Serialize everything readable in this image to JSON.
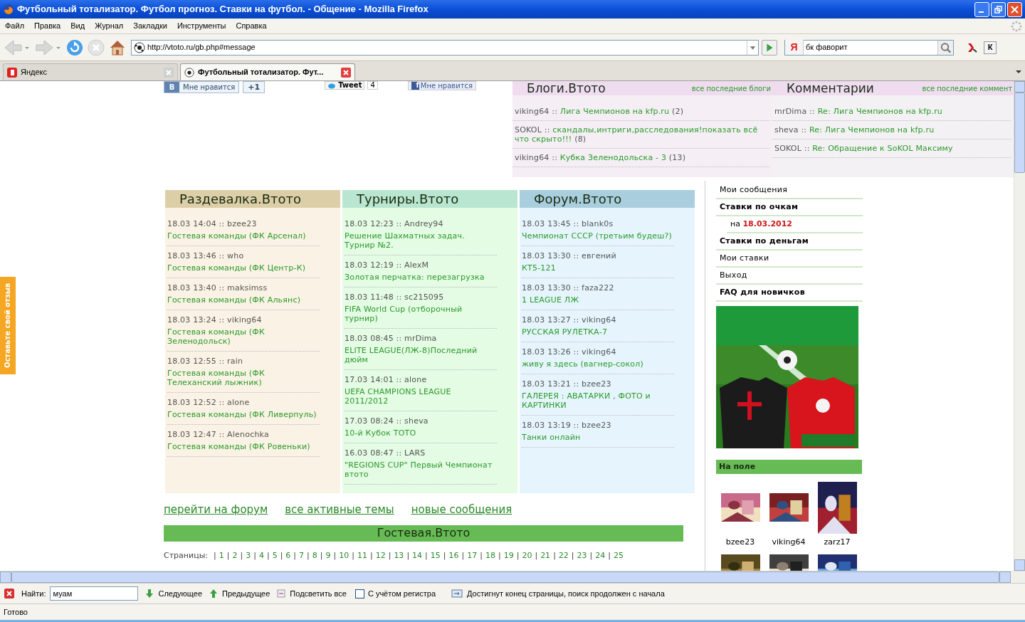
{
  "window": {
    "title": "Футбольный тотализатор. Футбол прогноз. Ставки на футбол. - Общение - Mozilla Firefox"
  },
  "menu": [
    "Файл",
    "Правка",
    "Вид",
    "Журнал",
    "Закладки",
    "Инструменты",
    "Справка"
  ],
  "toolbar": {
    "url": "http://vtoto.ru/gb.php#message",
    "engine": "Я",
    "search": "бк фаворит",
    "kav": "К"
  },
  "tabs": [
    {
      "label": "Яндекс",
      "selected": false
    },
    {
      "label": "Футбольный тотализатор. Фут...",
      "selected": true
    }
  ],
  "page": {
    "social": [
      {
        "kind": "vk",
        "icon": "В",
        "label": "Мне нравится",
        "count": "+1"
      },
      {
        "kind": "twitter",
        "label": "Tweet",
        "count": "4"
      },
      {
        "kind": "facebook",
        "icon": "f",
        "label": "Мне нравится"
      }
    ],
    "blogs": {
      "title": "Блоги.Втото",
      "link": "все последние блоги",
      "items": [
        {
          "author": "viking64 ::",
          "topic": "Лига Чемпионов на kfp.ru",
          "count": "(2)"
        },
        {
          "author": "SOKOL ::",
          "topic": "скандалы,интриги,расследования!показать всё что скрыто!!!",
          "count": "(8)"
        },
        {
          "author": "viking64 ::",
          "topic": "Кубка Зеленодольска - 3",
          "count": "(13)"
        }
      ]
    },
    "comments": {
      "title": "Комментарии",
      "link": "все последние коммент",
      "items": [
        {
          "author": "mrDima ::",
          "topic": "Re: Лига Чемпионов на kfp.ru"
        },
        {
          "author": "sheva ::",
          "topic": "Re: Лига Чемпионов на kfp.ru"
        },
        {
          "author": "SOKOL ::",
          "topic": "Re: Обращение к SoKOL Максиму"
        }
      ]
    },
    "sections": [
      {
        "title": "Раздевалка.Втото",
        "items": [
          {
            "meta": "18.03 14:04 :: bzee23",
            "topic": "Гостевая команды (ФК Арсенал)"
          },
          {
            "meta": "18.03 13:46 :: who",
            "topic": "Гостевая команды (ФК Центр-К)"
          },
          {
            "meta": "18.03 13:40 :: maksimss",
            "topic": "Гостевая команды (ФК Альянс)"
          },
          {
            "meta": "18.03 13:24 :: viking64",
            "topic": "Гостевая команды (ФК Зеленодольск)"
          },
          {
            "meta": "18.03 12:55 :: rain",
            "topic": "Гостевая команды (ФК Телеханский лыжник)"
          },
          {
            "meta": "18.03 12:52 :: alone",
            "topic": "Гостевая команды (ФК Ливерпуль)"
          },
          {
            "meta": "18.03 12:47 :: Alenochka",
            "topic": "Гостевая команды (ФК Ровеньки)"
          }
        ]
      },
      {
        "title": "Турниры.Втото",
        "items": [
          {
            "meta": "18.03 12:23 :: Andrey94",
            "topic": "Решение Шахматных задач. Турнир №2."
          },
          {
            "meta": "18.03 12:19 :: AlexM",
            "topic": "Золотая перчатка: перезагрузка"
          },
          {
            "meta": "18.03 11:48 :: sc215095",
            "topic": "FIFA World Cup (отборочный турнир)"
          },
          {
            "meta": "18.03 08:45 :: mrDima",
            "topic": "ELITE LEAGUE(ЛЖ-8)Последний дюйм"
          },
          {
            "meta": "17.03 14:01 :: alone",
            "topic": "UEFA CHAMPIONS LEAGUE 2011/2012"
          },
          {
            "meta": "17.03 08:24 :: sheva",
            "topic": "10-й Кубок ТОТО"
          },
          {
            "meta": "16.03 08:47 :: LARS",
            "topic": "\"REGIONS CUP\" Первый Чемпионат втото"
          }
        ]
      },
      {
        "title": "Форум.Втото",
        "items": [
          {
            "meta": "18.03 13:45 :: blank0s",
            "topic": "Чемпионат СССР (третьим будеш?)"
          },
          {
            "meta": "18.03 13:30 :: евгений",
            "topic": "КТ5-121"
          },
          {
            "meta": "18.03 13:30 :: faza222",
            "topic": "1 LEAGUE ЛЖ"
          },
          {
            "meta": "18.03 13:27 :: viking64",
            "topic": "РУССКАЯ РУЛЕТКА-7"
          },
          {
            "meta": "18.03 13:26 :: viking64",
            "topic": "живу я здесь (вагнер-сокол)"
          },
          {
            "meta": "18.03 13:21 :: bzee23",
            "topic": "ГАЛЕРЕЯ : АВАТАРКИ , ФОТО и КАРТИНКИ"
          },
          {
            "meta": "18.03 13:19 :: bzee23",
            "topic": "Танки онлайн"
          }
        ]
      }
    ],
    "links": [
      "перейти на форум",
      "все активные темы",
      "новые сообщения"
    ],
    "guestbook": "Гостевая.Втото",
    "pages_label": "Страницы:",
    "separator": "|",
    "pages": [
      "1",
      "2",
      "3",
      "4",
      "5",
      "6",
      "7",
      "8",
      "9",
      "10",
      "11",
      "12",
      "13",
      "14",
      "15",
      "16",
      "17",
      "18",
      "19",
      "20",
      "21",
      "22",
      "23",
      "24",
      "25"
    ],
    "sidebar": {
      "menu": [
        {
          "kind": "link",
          "label": "Мои сообщения",
          "bold": false
        },
        {
          "kind": "link",
          "label": "Ставки по очкам",
          "bold": true
        },
        {
          "kind": "date",
          "label": "на",
          "date": "18.03.2012",
          "bold": false
        },
        {
          "kind": "link",
          "label": "Ставки по деньгам",
          "bold": true
        },
        {
          "kind": "link",
          "label": "Мои ставки",
          "bold": false
        },
        {
          "kind": "link",
          "label": "Выход",
          "bold": false
        },
        {
          "kind": "link",
          "label": "FAQ для новичков",
          "bold": true
        }
      ],
      "online_title": "На поле",
      "online": [
        {
          "name": "bzee23"
        },
        {
          "name": "viking64"
        },
        {
          "name": "zarz17"
        }
      ]
    },
    "feedback": "Оставьте свой отзыв"
  },
  "find_bar": {
    "label": "Найти:",
    "value": "муам",
    "next": "Следующее",
    "prev": "Предыдущее",
    "highlight": "Подсветить все",
    "match_case": {
      "label": "С учётом регистра",
      "checked": false
    },
    "message": "Достигнут конец страницы, поиск продолжен с начала"
  },
  "status": "Готово"
}
